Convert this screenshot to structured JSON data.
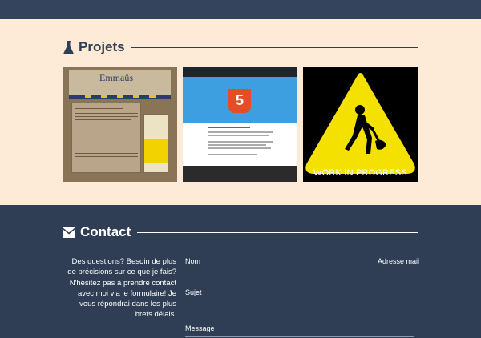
{
  "projects": {
    "title": "Projets",
    "icon": "flask-icon",
    "items": [
      {
        "name": "project-emmaus",
        "logo_text": "Emmaüs"
      },
      {
        "name": "project-html5",
        "badge": "5"
      },
      {
        "name": "project-wip",
        "caption": "WORK IN PROGRESS"
      }
    ]
  },
  "contact": {
    "title": "Contact",
    "icon": "envelope-icon",
    "blurb": "Des questions? Besoin de plus de précisions sur ce que je fais? N'hésitez pas à prendre contact avec moi via le formulaire! Je vous répondrai dans les plus brefs délais.",
    "form": {
      "name_label": "Nom",
      "email_label": "Adresse mail",
      "subject_label": "Sujet",
      "message_label": "Message"
    }
  },
  "colors": {
    "navy": "#2f3e55",
    "cream": "#fdebd8",
    "warning_yellow": "#f5e100"
  }
}
